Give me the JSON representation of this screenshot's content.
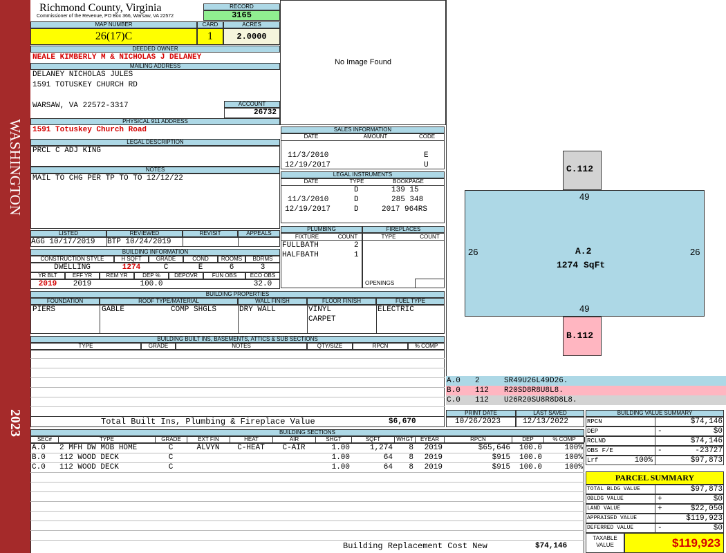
{
  "sidebar": {
    "district": "WASHINGTON",
    "year": "2023"
  },
  "header": {
    "county": "Richmond County, Virginia",
    "address": "Commissioner of the Revenue, PO Box 366, Warsaw, VA 22572",
    "record_label": "RECORD",
    "record": "3165",
    "map_label": "MAP NUMBER",
    "map_number": "26(17)C",
    "card_label": "CARD",
    "card": "1",
    "acres_label": "ACRES",
    "acres": "2.0000"
  },
  "owner": {
    "label": "DEEDED OWNER",
    "name": "NEALE KIMBERLY M & NICHOLAS J DELANEY"
  },
  "mailing": {
    "label": "MAILING ADDRESS",
    "line1": "DELANEY NICHOLAS JULES",
    "line2": "1591 TOTUSKEY CHURCH RD",
    "line3": "WARSAW, VA 22572-3317",
    "account_label": "ACCOUNT",
    "account": "26732"
  },
  "physical": {
    "label": "PHYSICAL 911 ADDRESS",
    "address": "1591 Totuskey Church Road"
  },
  "legal": {
    "label": "LEGAL DESCRIPTION",
    "text": "PRCL C ADJ KING"
  },
  "notes": {
    "label": "NOTES",
    "text": "MAIL TO CHG PER TP TO TO 12/12/22"
  },
  "image": {
    "text": "No Image Found"
  },
  "sales": {
    "label": "SALES INFORMATION",
    "headers": [
      "DATE",
      "AMOUNT",
      "CODE"
    ],
    "rows": [
      {
        "date": "11/3/2010",
        "amount": "",
        "code": "E"
      },
      {
        "date": "12/19/2017",
        "amount": "",
        "code": "U"
      }
    ]
  },
  "instruments": {
    "label": "LEGAL INSTRUMENTS",
    "headers": [
      "DATE",
      "TYPE",
      "BOOKPAGE"
    ],
    "rows": [
      {
        "date": "",
        "type": "D",
        "book": "139 15"
      },
      {
        "date": "11/3/2010",
        "type": "D",
        "book": "285 348"
      },
      {
        "date": "12/19/2017",
        "type": "D",
        "book": "2017 964RS"
      }
    ]
  },
  "plumbing": {
    "label": "PLUMBING",
    "headers": [
      "FIXTURE",
      "COUNT"
    ],
    "rows": [
      {
        "fixture": "FULLBATH",
        "count": "2"
      },
      {
        "fixture": "HALFBATH",
        "count": "1"
      }
    ]
  },
  "fireplaces": {
    "label": "FIREPLACES",
    "headers": [
      "TYPE",
      "COUNT"
    ],
    "openings": "OPENINGS"
  },
  "review": {
    "headers": [
      "LISTED",
      "REVIEWED",
      "REVISIT",
      "APPEALS"
    ],
    "listed": "AGG 10/17/2019",
    "reviewed": "BTP 10/24/2019"
  },
  "building": {
    "label": "BUILDING INFORMATION",
    "headers": [
      "CONSTRUCTION STYLE",
      "H SQFT",
      "GRADE",
      "COND",
      "ROOMS",
      "BDRMS"
    ],
    "style": "DWELLING",
    "hsqft": "1274",
    "grade": "C",
    "cond": "E",
    "rooms": "6",
    "bdrms": "3",
    "headers2": [
      "YR BLT",
      "EFF YR",
      "REM YR",
      "DEP %",
      "DEPOVR",
      "FUN OBS",
      "ECO OBS"
    ],
    "yrblt": "2019",
    "effyr": "2019",
    "dep": "100.0",
    "eco": "32.0"
  },
  "properties": {
    "label": "BUILDING PROPERTIES",
    "headers": [
      "FOUNDATION",
      "ROOF TYPE/MATERIAL",
      "WALL FINISH",
      "FLOOR FINISH",
      "FUEL TYPE"
    ],
    "foundation": "PIERS",
    "roof_type": "GABLE",
    "roof_mat": "COMP SHGLS",
    "wall": "DRY WALL",
    "floor1": "VINYL",
    "floor2": "CARPET",
    "fuel": "ELECTRIC"
  },
  "builtins": {
    "label": "BUILDING BUILT INS, BASEMENTS, ATTICS & SUB SECTIONS",
    "headers": [
      "TYPE",
      "GRADE",
      "NOTES",
      "QTY/SIZE",
      "RPCN",
      "% COMP"
    ],
    "total_label": "Total Built Ins, Plumbing & Fireplace Value",
    "total": "$6,670"
  },
  "sketch": {
    "main": "A.2",
    "main_area": "1274 SqFt",
    "top": "C.112",
    "bottom": "B.112",
    "dim_top": "49",
    "dim_bottom": "49",
    "dim_left": "26",
    "dim_right": "26",
    "rows": [
      {
        "sec": "A.0",
        "code": "2",
        "desc": "SR49U26L49D26."
      },
      {
        "sec": "B.0",
        "code": "112",
        "desc": "R20SD8R8U8L8."
      },
      {
        "sec": "C.0",
        "code": "112",
        "desc": "U26R20SU8R8D8L8."
      }
    ],
    "colors": {
      "main": "#add8e6",
      "b": "#ffb6c1",
      "c": "#d3d3d3"
    }
  },
  "dates": {
    "print_label": "PRINT DATE",
    "print": "10/26/2023",
    "saved_label": "LAST SAVED",
    "saved": "12/13/2022"
  },
  "sections": {
    "label": "BUILDING SECTIONS",
    "headers": [
      "SEC#",
      "TYPE",
      "GRADE",
      "EXT FIN",
      "HEAT",
      "AIR",
      "SHGT",
      "SQFT",
      "WHGT",
      "EYEAR",
      "RPCN",
      "DEP",
      "% COMP"
    ],
    "rows": [
      {
        "sec": "A.0",
        "type": "2 MFH DW MOB HOME",
        "grade": "C",
        "ext": "ALVYN",
        "heat": "C-HEAT",
        "air": "C-AIR",
        "shgt": "1.00",
        "sqft": "1,274",
        "whgt": "8",
        "eyear": "2019",
        "rpcn": "$65,646",
        "dep": "100.0",
        "comp": "100%"
      },
      {
        "sec": "B.0",
        "type": "112 WOOD DECK",
        "grade": "C",
        "ext": "",
        "heat": "",
        "air": "",
        "shgt": "1.00",
        "sqft": "64",
        "whgt": "8",
        "eyear": "2019",
        "rpcn": "$915",
        "dep": "100.0",
        "comp": "100%"
      },
      {
        "sec": "C.0",
        "type": "112 WOOD DECK",
        "grade": "C",
        "ext": "",
        "heat": "",
        "air": "",
        "shgt": "1.00",
        "sqft": "64",
        "whgt": "8",
        "eyear": "2019",
        "rpcn": "$915",
        "dep": "100.0",
        "comp": "100%"
      }
    ],
    "total_label": "Building Replacement Cost New",
    "total": "$74,146"
  },
  "value_summary": {
    "label": "BUILDING VALUE SUMMARY",
    "rows": [
      {
        "k": "RPCN",
        "op": "",
        "pct": "",
        "v": "$74,146"
      },
      {
        "k": "DEP",
        "op": "-",
        "pct": "",
        "v": "$0"
      },
      {
        "k": "RCLND",
        "op": "",
        "pct": "",
        "v": "$74,146"
      },
      {
        "k": "OBS F/E",
        "op": "-",
        "pct": "",
        "v": "-23727"
      },
      {
        "k": "Lrf",
        "op": "",
        "pct": "100%",
        "v": "$97,873"
      }
    ]
  },
  "parcel": {
    "label": "PARCEL SUMMARY",
    "rows": [
      {
        "k": "TOTAL BLDG VALUE",
        "op": "",
        "v": "$97,873"
      },
      {
        "k": "OBLDG VALUE",
        "op": "+",
        "v": "$0"
      },
      {
        "k": "LAND VALUE",
        "op": "+",
        "v": "$22,050"
      },
      {
        "k": "APPRAISED VALUE",
        "op": "",
        "v": "$119,923"
      },
      {
        "k": "DEFERRED VALUE",
        "op": "-",
        "v": "$0"
      }
    ],
    "taxable_label1": "TAXABLE",
    "taxable_label2": "VALUE",
    "taxable": "$119,923"
  }
}
